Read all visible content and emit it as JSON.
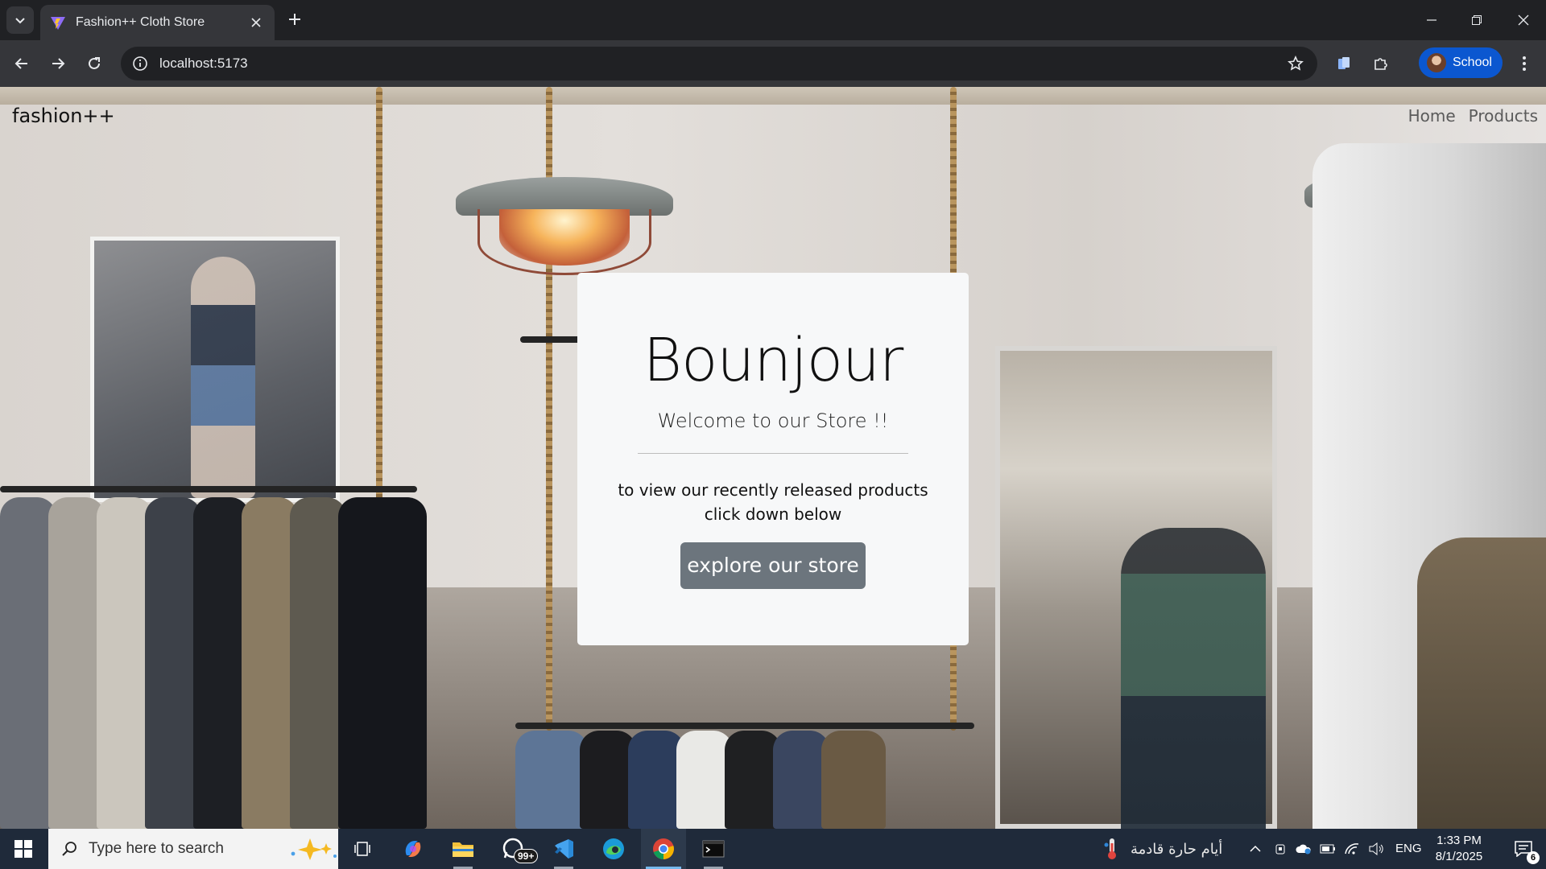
{
  "browser": {
    "tab_title": "Fashion++ Cloth Store",
    "url": "localhost:5173",
    "profile_name": "School"
  },
  "site": {
    "brand": "fashion++",
    "nav": [
      "Home",
      "Products"
    ],
    "card": {
      "heading": "Bounjour",
      "lead": "Welcome to our Store !!",
      "desc_line1": "to view our recently released products",
      "desc_line2": "click down below",
      "button": "explore our store"
    }
  },
  "taskbar": {
    "search_placeholder": "Type here to search",
    "whatsapp_badge": "99+",
    "weather_text": "أيام حارة قادمة",
    "language": "ENG",
    "time": "1:33 PM",
    "date": "8/1/2025",
    "notification_count": "6"
  },
  "colors": {
    "chrome_dark": "#202124",
    "chrome_toolbar": "#35363a",
    "profile_blue": "#0b57d0",
    "card_bg": "#f7f8f9",
    "button_gray": "#6c757d",
    "taskbar": "#1f2a3a"
  }
}
